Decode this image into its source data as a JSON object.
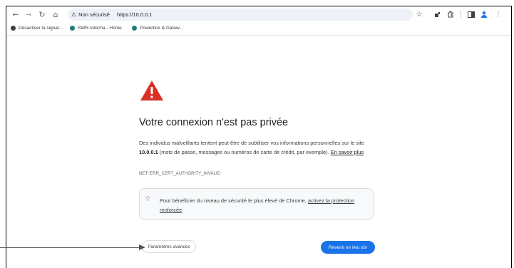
{
  "toolbar": {
    "back_icon": "back-arrow-icon",
    "forward_icon": "forward-arrow-icon",
    "reload_icon": "reload-icon",
    "home_icon": "home-icon",
    "security_chip": "Non sécurisé",
    "url": "https://10.0.0.1",
    "star_icon": "bookmark-star-icon",
    "icons": [
      "extension-icon",
      "puzzle-icon",
      "sidebar-icon",
      "profile-icon",
      "menu-icon"
    ]
  },
  "bookmarks": [
    {
      "label": "Désactiver la signat...",
      "color": "#3c4043"
    },
    {
      "label": "SWR-Iotecha - Home",
      "color": "#1b7f7a"
    },
    {
      "label": "Powerbox & Gatew...",
      "color": "#1b7f7a"
    }
  ],
  "page": {
    "title": "Votre connexion n'est pas privée",
    "para_part1": "Des individus malveillants tentent peut-être de subtiliser vos informations personnelles sur le site ",
    "para_host": "10.0.0.1",
    "para_part2": " (mots de passe, messages ou numéros de carte de crédit, par exemple). ",
    "para_link": "En savoir plus",
    "error_code": "NET::ERR_CERT_AUTHORITY_INVALID",
    "tip_text": "Pour bénéficier du niveau de sécurité le plus élevé de Chrome, ",
    "tip_link": "activez la protection renforcée",
    "advanced_button": "Paramètres avancés",
    "back_button": "Revenir en lieu sûr"
  },
  "colors": {
    "warning_red": "#d93025",
    "primary_blue": "#1a73e8"
  }
}
